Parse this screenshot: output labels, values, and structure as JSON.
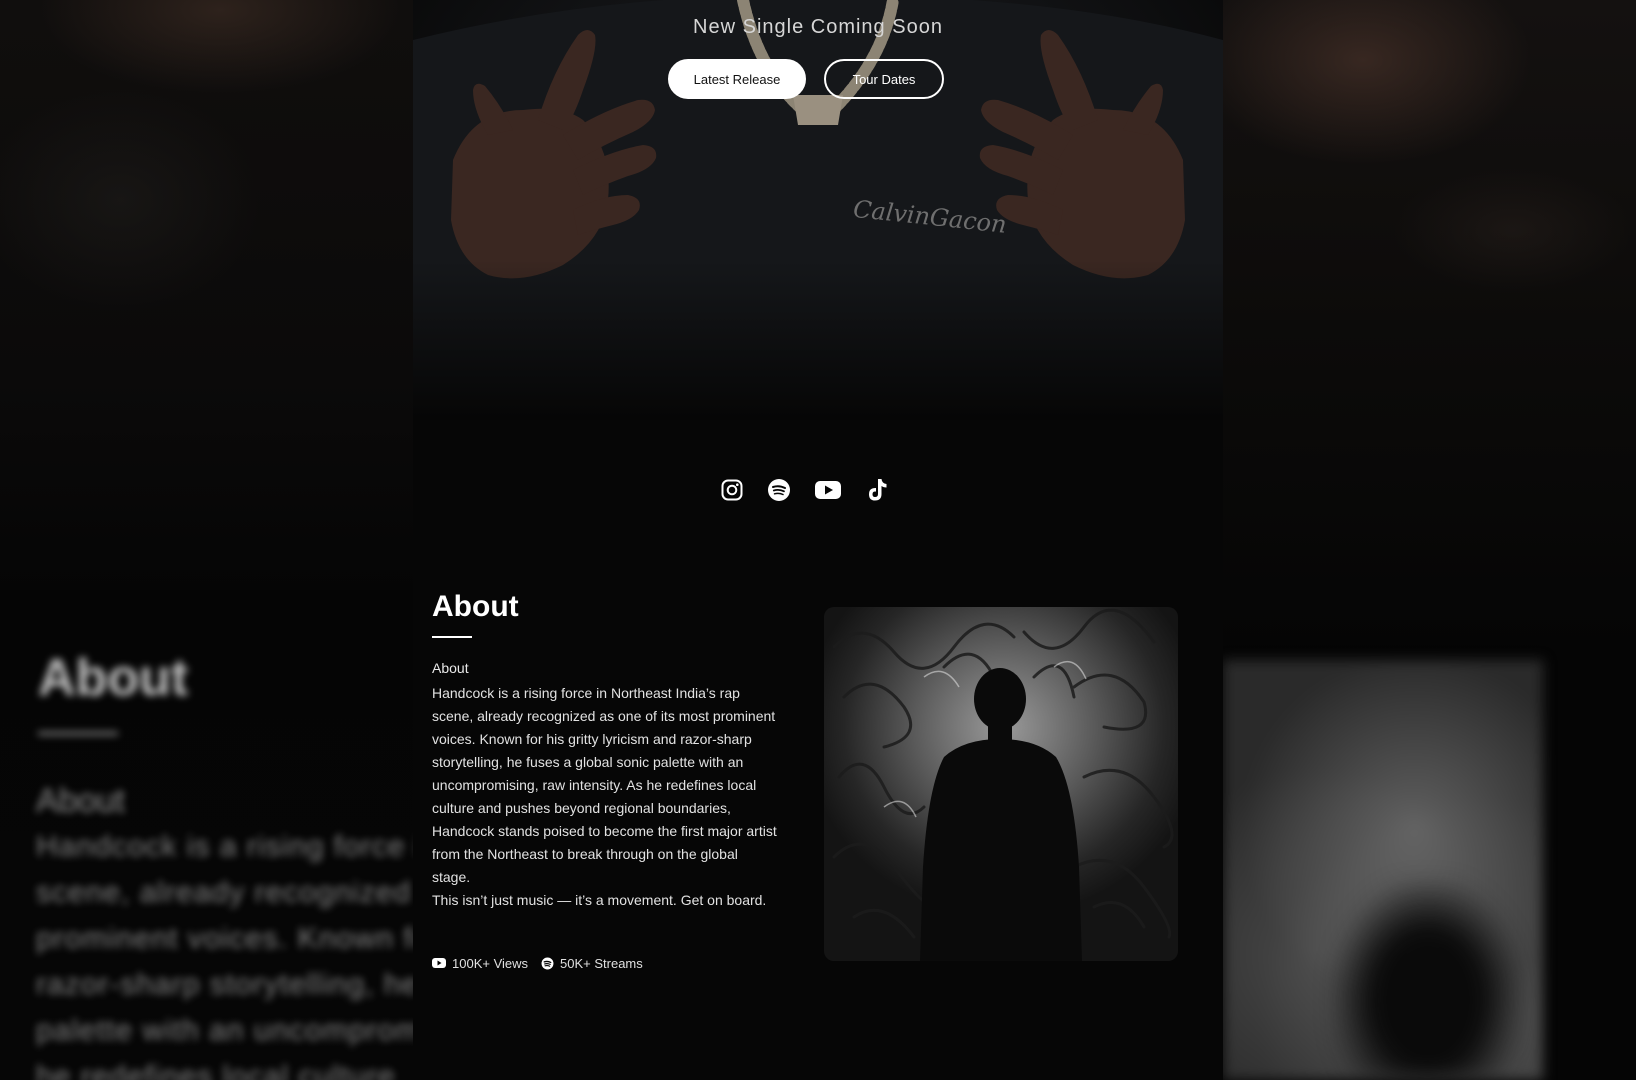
{
  "hero": {
    "title": "New Single Coming Soon",
    "primary_button": "Latest Release",
    "secondary_button": "Tour Dates",
    "shirt_text": "CalvinGacon"
  },
  "socials": [
    {
      "name": "instagram-icon"
    },
    {
      "name": "spotify-icon"
    },
    {
      "name": "youtube-icon"
    },
    {
      "name": "tiktok-icon"
    }
  ],
  "about": {
    "heading": "About",
    "subheading": "About",
    "paragraph1": "Handcock is a rising force in Northeast India’s rap scene, already recognized as one of its most prominent voices. Known for his gritty lyricism and razor-sharp storytelling, he fuses a global sonic palette with an uncompromising, raw intensity. As he redefines local culture and pushes beyond regional boundaries, Handcock stands poised to become the first major artist from the Northeast to break through on the global stage.",
    "paragraph2": "This isn’t just music — it’s a movement. Get on board.",
    "stats": [
      {
        "icon": "youtube-icon",
        "label": "100K+ Views"
      },
      {
        "icon": "spotify-icon",
        "label": "50K+ Streams"
      }
    ]
  },
  "colors": {
    "background": "#060606",
    "text": "#ffffff",
    "button_primary_bg": "#ffffff",
    "button_primary_text": "#111111"
  }
}
